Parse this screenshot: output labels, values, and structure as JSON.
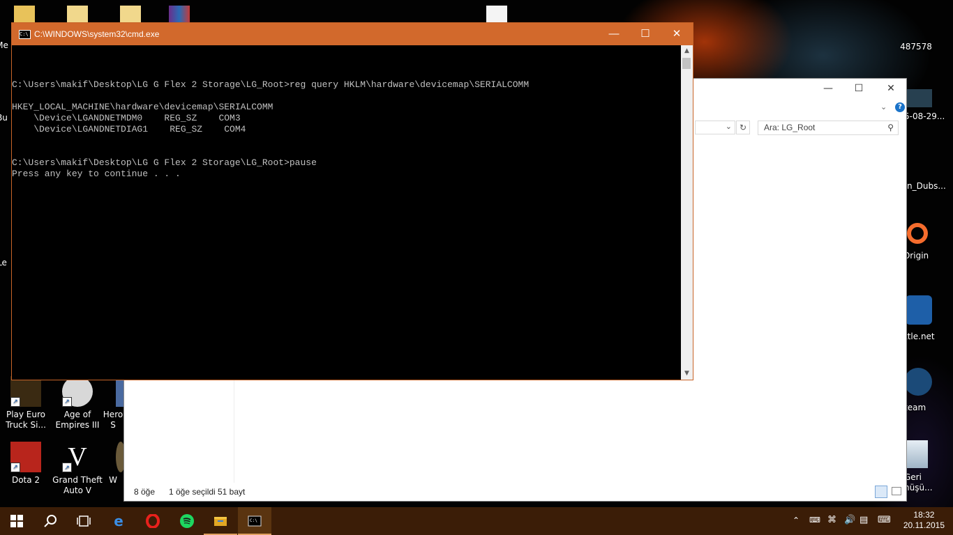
{
  "desktop": {
    "icons": [
      {
        "label": "Play Euro\nTruck Si...",
        "name": "desktop-icon-euro-truck"
      },
      {
        "label": "Age of\nEmpires III",
        "name": "desktop-icon-age-of-empires"
      },
      {
        "label": "Hero\nS",
        "name": "desktop-icon-heroes"
      },
      {
        "label": "Dota 2",
        "name": "desktop-icon-dota2"
      },
      {
        "label": "Grand Theft\nAuto V",
        "name": "desktop-icon-gta5"
      },
      {
        "label": "W",
        "name": "desktop-icon-w"
      }
    ],
    "right_icons": [
      {
        "label": "487578"
      },
      {
        "label": "5-08-29..."
      },
      {
        "label": "n_Dubs..."
      },
      {
        "label": "Origin"
      },
      {
        "label": "ttle.net"
      },
      {
        "label": "team"
      },
      {
        "label": "Geri\nnüşü..."
      }
    ],
    "left_partial": [
      {
        "label": "Me"
      },
      {
        "label": "Bu"
      },
      {
        "label": "Le"
      }
    ]
  },
  "cmd": {
    "title": "C:\\WINDOWS\\system32\\cmd.exe",
    "lines": [
      "C:\\Users\\makif\\Desktop\\LG G Flex 2 Storage\\LG_Root>reg query HKLM\\hardware\\devicemap\\SERIALCOMM",
      "",
      "HKEY_LOCAL_MACHINE\\hardware\\devicemap\\SERIALCOMM",
      "    \\Device\\LGANDNETMDM0    REG_SZ    COM3",
      "    \\Device\\LGANDNETDIAG1    REG_SZ    COM4",
      "",
      "",
      "C:\\Users\\makif\\Desktop\\LG G Flex 2 Storage\\LG_Root>pause",
      "Press any key to continue . . ."
    ]
  },
  "explorer": {
    "search_placeholder": "Ara: LG_Root",
    "status_count": "8 öğe",
    "status_selected": "1 öğe seçildi",
    "status_size": "51 bayt"
  },
  "taskbar": {
    "time": "18:32",
    "date": "20.11.2015"
  },
  "colors": {
    "cmd_titlebar": "#d2692c",
    "taskbar": "#3b1d07"
  }
}
